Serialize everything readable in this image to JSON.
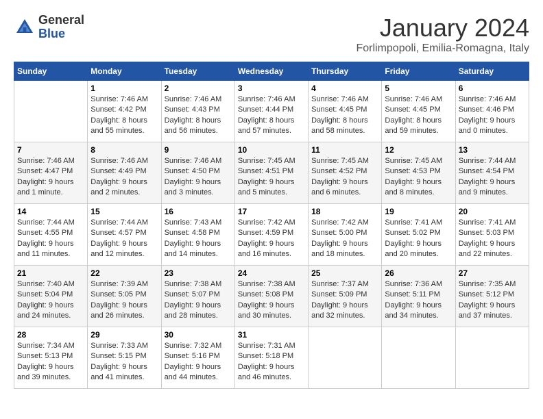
{
  "header": {
    "logo_general": "General",
    "logo_blue": "Blue",
    "month_title": "January 2024",
    "location": "Forlimpopoli, Emilia-Romagna, Italy"
  },
  "days_of_week": [
    "Sunday",
    "Monday",
    "Tuesday",
    "Wednesday",
    "Thursday",
    "Friday",
    "Saturday"
  ],
  "weeks": [
    [
      {
        "day": "",
        "info": ""
      },
      {
        "day": "1",
        "info": "Sunrise: 7:46 AM\nSunset: 4:42 PM\nDaylight: 8 hours\nand 55 minutes."
      },
      {
        "day": "2",
        "info": "Sunrise: 7:46 AM\nSunset: 4:43 PM\nDaylight: 8 hours\nand 56 minutes."
      },
      {
        "day": "3",
        "info": "Sunrise: 7:46 AM\nSunset: 4:44 PM\nDaylight: 8 hours\nand 57 minutes."
      },
      {
        "day": "4",
        "info": "Sunrise: 7:46 AM\nSunset: 4:45 PM\nDaylight: 8 hours\nand 58 minutes."
      },
      {
        "day": "5",
        "info": "Sunrise: 7:46 AM\nSunset: 4:45 PM\nDaylight: 8 hours\nand 59 minutes."
      },
      {
        "day": "6",
        "info": "Sunrise: 7:46 AM\nSunset: 4:46 PM\nDaylight: 9 hours\nand 0 minutes."
      }
    ],
    [
      {
        "day": "7",
        "info": "Sunrise: 7:46 AM\nSunset: 4:47 PM\nDaylight: 9 hours\nand 1 minute."
      },
      {
        "day": "8",
        "info": "Sunrise: 7:46 AM\nSunset: 4:49 PM\nDaylight: 9 hours\nand 2 minutes."
      },
      {
        "day": "9",
        "info": "Sunrise: 7:46 AM\nSunset: 4:50 PM\nDaylight: 9 hours\nand 3 minutes."
      },
      {
        "day": "10",
        "info": "Sunrise: 7:45 AM\nSunset: 4:51 PM\nDaylight: 9 hours\nand 5 minutes."
      },
      {
        "day": "11",
        "info": "Sunrise: 7:45 AM\nSunset: 4:52 PM\nDaylight: 9 hours\nand 6 minutes."
      },
      {
        "day": "12",
        "info": "Sunrise: 7:45 AM\nSunset: 4:53 PM\nDaylight: 9 hours\nand 8 minutes."
      },
      {
        "day": "13",
        "info": "Sunrise: 7:44 AM\nSunset: 4:54 PM\nDaylight: 9 hours\nand 9 minutes."
      }
    ],
    [
      {
        "day": "14",
        "info": "Sunrise: 7:44 AM\nSunset: 4:55 PM\nDaylight: 9 hours\nand 11 minutes."
      },
      {
        "day": "15",
        "info": "Sunrise: 7:44 AM\nSunset: 4:57 PM\nDaylight: 9 hours\nand 12 minutes."
      },
      {
        "day": "16",
        "info": "Sunrise: 7:43 AM\nSunset: 4:58 PM\nDaylight: 9 hours\nand 14 minutes."
      },
      {
        "day": "17",
        "info": "Sunrise: 7:42 AM\nSunset: 4:59 PM\nDaylight: 9 hours\nand 16 minutes."
      },
      {
        "day": "18",
        "info": "Sunrise: 7:42 AM\nSunset: 5:00 PM\nDaylight: 9 hours\nand 18 minutes."
      },
      {
        "day": "19",
        "info": "Sunrise: 7:41 AM\nSunset: 5:02 PM\nDaylight: 9 hours\nand 20 minutes."
      },
      {
        "day": "20",
        "info": "Sunrise: 7:41 AM\nSunset: 5:03 PM\nDaylight: 9 hours\nand 22 minutes."
      }
    ],
    [
      {
        "day": "21",
        "info": "Sunrise: 7:40 AM\nSunset: 5:04 PM\nDaylight: 9 hours\nand 24 minutes."
      },
      {
        "day": "22",
        "info": "Sunrise: 7:39 AM\nSunset: 5:05 PM\nDaylight: 9 hours\nand 26 minutes."
      },
      {
        "day": "23",
        "info": "Sunrise: 7:38 AM\nSunset: 5:07 PM\nDaylight: 9 hours\nand 28 minutes."
      },
      {
        "day": "24",
        "info": "Sunrise: 7:38 AM\nSunset: 5:08 PM\nDaylight: 9 hours\nand 30 minutes."
      },
      {
        "day": "25",
        "info": "Sunrise: 7:37 AM\nSunset: 5:09 PM\nDaylight: 9 hours\nand 32 minutes."
      },
      {
        "day": "26",
        "info": "Sunrise: 7:36 AM\nSunset: 5:11 PM\nDaylight: 9 hours\nand 34 minutes."
      },
      {
        "day": "27",
        "info": "Sunrise: 7:35 AM\nSunset: 5:12 PM\nDaylight: 9 hours\nand 37 minutes."
      }
    ],
    [
      {
        "day": "28",
        "info": "Sunrise: 7:34 AM\nSunset: 5:13 PM\nDaylight: 9 hours\nand 39 minutes."
      },
      {
        "day": "29",
        "info": "Sunrise: 7:33 AM\nSunset: 5:15 PM\nDaylight: 9 hours\nand 41 minutes."
      },
      {
        "day": "30",
        "info": "Sunrise: 7:32 AM\nSunset: 5:16 PM\nDaylight: 9 hours\nand 44 minutes."
      },
      {
        "day": "31",
        "info": "Sunrise: 7:31 AM\nSunset: 5:18 PM\nDaylight: 9 hours\nand 46 minutes."
      },
      {
        "day": "",
        "info": ""
      },
      {
        "day": "",
        "info": ""
      },
      {
        "day": "",
        "info": ""
      }
    ]
  ]
}
